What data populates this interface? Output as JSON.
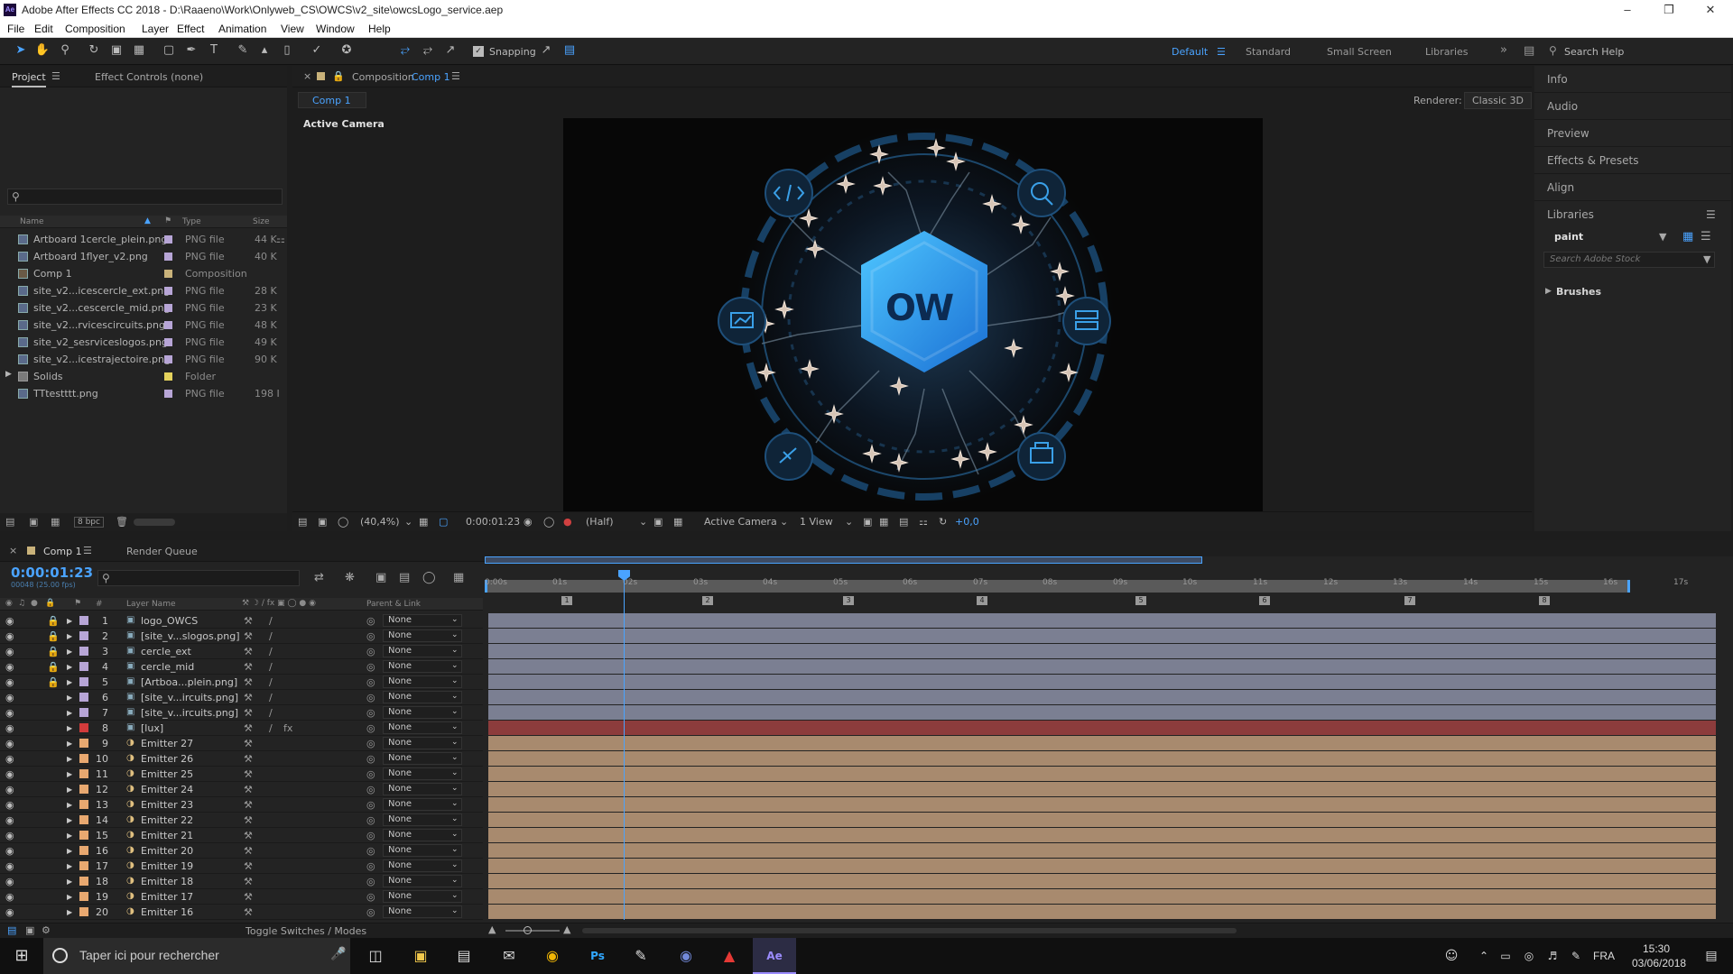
{
  "window": {
    "title": "Adobe After Effects CC 2018 - D:\\Raaeno\\Work\\Onlyweb_CS\\OWCS\\v2_site\\owcsLogo_service.aep",
    "app_icon": "Ae"
  },
  "menu": [
    "File",
    "Edit",
    "Composition",
    "Layer",
    "Effect",
    "Animation",
    "View",
    "Window",
    "Help"
  ],
  "toolbar": {
    "snapping_label": "Snapping",
    "workspaces": [
      "Default",
      "Standard",
      "Small Screen",
      "Libraries"
    ],
    "search_placeholder": "Search Help"
  },
  "project_panel": {
    "tab_project": "Project",
    "tab_effect_controls": "Effect Controls (none)",
    "columns": [
      "Name",
      "Type",
      "Size"
    ],
    "bpc": "8 bpc",
    "items": [
      {
        "name": "Artboard 1cercle_plein.png",
        "type": "PNG file",
        "size": "44 K",
        "color": "#b7a5d6"
      },
      {
        "name": "Artboard 1flyer_v2.png",
        "type": "PNG file",
        "size": "40 K",
        "color": "#b7a5d6"
      },
      {
        "name": "Comp 1",
        "type": "Composition",
        "size": "",
        "color": "#c9b27a"
      },
      {
        "name": "site_v2...icescercle_ext.png",
        "type": "PNG file",
        "size": "28 K",
        "color": "#b7a5d6"
      },
      {
        "name": "site_v2...cescercle_mid.png",
        "type": "PNG file",
        "size": "23 K",
        "color": "#b7a5d6"
      },
      {
        "name": "site_v2...rvicescircuits.png",
        "type": "PNG file",
        "size": "48 K",
        "color": "#b7a5d6"
      },
      {
        "name": "site_v2_sesrviceslogos.png",
        "type": "PNG file",
        "size": "49 K",
        "color": "#b7a5d6"
      },
      {
        "name": "site_v2...icestrajectoire.png",
        "type": "PNG file",
        "size": "90 K",
        "color": "#b7a5d6"
      },
      {
        "name": "Solids",
        "type": "Folder",
        "size": "",
        "color": "#e4d25c"
      },
      {
        "name": "TTtestttt.png",
        "type": "PNG file",
        "size": "198 I",
        "color": "#b7a5d6"
      }
    ]
  },
  "composition_panel": {
    "tab_label": "Composition",
    "comp_name": "Comp 1",
    "subtab": "Comp 1",
    "renderer_label": "Renderer:",
    "renderer_value": "Classic 3D",
    "camera_label": "Active Camera",
    "logo_text": "OW",
    "footer": {
      "zoom": "(40,4%)",
      "timecode": "0:00:01:23",
      "resolution": "(Half)",
      "camera": "Active Camera",
      "views": "1 View",
      "exposure": "+0,0"
    }
  },
  "right_panel": {
    "items": [
      "Info",
      "Audio",
      "Preview",
      "Effects & Presets",
      "Align",
      "Libraries"
    ],
    "library_select": "paint",
    "stock_placeholder": "Search Adobe Stock",
    "brushes": "Brushes"
  },
  "timeline": {
    "tab_comp": "Comp 1",
    "tab_render_queue": "Render Queue",
    "timecode": "0:00:01:23",
    "frames": "00048 (25.00 fps)",
    "col_layer_name": "Layer Name",
    "col_parent": "Parent & Link",
    "col_num": "#",
    "toggle_label": "Toggle Switches / Modes",
    "ruler": [
      "0:00s",
      "01s",
      "02s",
      "03s",
      "04s",
      "05s",
      "06s",
      "07s",
      "08s",
      "09s",
      "10s",
      "11s",
      "12s",
      "13s",
      "14s",
      "15s",
      "16s",
      "17s"
    ],
    "markers": [
      "1",
      "2",
      "3",
      "4",
      "5",
      "6",
      "7",
      "8"
    ],
    "layers": [
      {
        "num": "1",
        "name": "logo_OWCS",
        "parent": "None",
        "color": "#b7a5d6",
        "bar": "#7b7f92"
      },
      {
        "num": "2",
        "name": "[site_v...slogos.png]",
        "parent": "None",
        "color": "#b7a5d6",
        "bar": "#7b7f92"
      },
      {
        "num": "3",
        "name": "cercle_ext",
        "parent": "None",
        "color": "#b7a5d6",
        "bar": "#7b7f92"
      },
      {
        "num": "4",
        "name": "cercle_mid",
        "parent": "None",
        "color": "#b7a5d6",
        "bar": "#7b7f92"
      },
      {
        "num": "5",
        "name": "[Artboa...plein.png]",
        "parent": "None",
        "color": "#b7a5d6",
        "bar": "#7b7f92"
      },
      {
        "num": "6",
        "name": "[site_v...ircuits.png]",
        "parent": "None",
        "color": "#b7a5d6",
        "bar": "#7b7f92"
      },
      {
        "num": "7",
        "name": "[site_v...ircuits.png]",
        "parent": "None",
        "color": "#b7a5d6",
        "bar": "#7b7f92"
      },
      {
        "num": "8",
        "name": "[lux]",
        "parent": "None",
        "color": "#d23b3b",
        "bar": "#8c3c3c"
      },
      {
        "num": "9",
        "name": "Emitter 27",
        "parent": "None",
        "color": "#e8a870",
        "bar": "#a88a6e"
      },
      {
        "num": "10",
        "name": "Emitter 26",
        "parent": "None",
        "color": "#e8a870",
        "bar": "#a88a6e"
      },
      {
        "num": "11",
        "name": "Emitter 25",
        "parent": "None",
        "color": "#e8a870",
        "bar": "#a88a6e"
      },
      {
        "num": "12",
        "name": "Emitter 24",
        "parent": "None",
        "color": "#e8a870",
        "bar": "#a88a6e"
      },
      {
        "num": "13",
        "name": "Emitter 23",
        "parent": "None",
        "color": "#e8a870",
        "bar": "#a88a6e"
      },
      {
        "num": "14",
        "name": "Emitter 22",
        "parent": "None",
        "color": "#e8a870",
        "bar": "#a88a6e"
      },
      {
        "num": "15",
        "name": "Emitter 21",
        "parent": "None",
        "color": "#e8a870",
        "bar": "#a88a6e"
      },
      {
        "num": "16",
        "name": "Emitter 20",
        "parent": "None",
        "color": "#e8a870",
        "bar": "#a88a6e"
      },
      {
        "num": "17",
        "name": "Emitter 19",
        "parent": "None",
        "color": "#e8a870",
        "bar": "#a88a6e"
      },
      {
        "num": "18",
        "name": "Emitter 18",
        "parent": "None",
        "color": "#e8a870",
        "bar": "#a88a6e"
      },
      {
        "num": "19",
        "name": "Emitter 17",
        "parent": "None",
        "color": "#e8a870",
        "bar": "#a88a6e"
      },
      {
        "num": "20",
        "name": "Emitter 16",
        "parent": "None",
        "color": "#e8a870",
        "bar": "#a88a6e"
      }
    ]
  },
  "taskbar": {
    "search_placeholder": "Taper ici pour rechercher",
    "lang": "FRA",
    "time": "15:30",
    "date": "03/06/2018"
  }
}
